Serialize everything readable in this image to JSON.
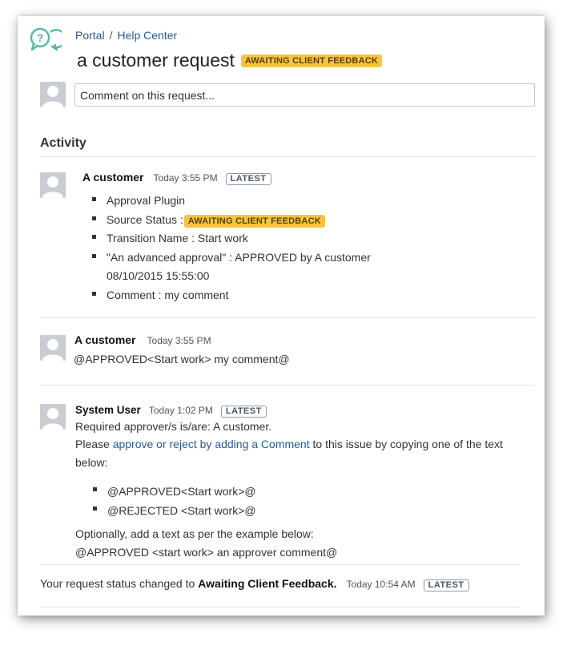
{
  "breadcrumb": {
    "portal": "Portal",
    "separator": "/",
    "help_center": "Help Center"
  },
  "request": {
    "title": "a customer request",
    "status": "AWAITING CLIENT FEEDBACK"
  },
  "comment_box": {
    "placeholder": "Comment on this request..."
  },
  "activity": {
    "heading": "Activity",
    "entries": [
      {
        "author": "A customer",
        "time": "Today 3:55 PM",
        "badge": "LATEST",
        "items": [
          {
            "text": "Approval Plugin"
          },
          {
            "label": "Source Status :",
            "status": "AWAITING CLIENT FEEDBACK"
          },
          {
            "text": "Transition Name : Start work"
          },
          {
            "text": "\"An advanced approval\" : APPROVED by A customer",
            "text2": "08/10/2015 15:55:00"
          },
          {
            "text": "Comment : my comment"
          }
        ]
      },
      {
        "author": "A customer",
        "time": "Today 3:55 PM",
        "body": "@APPROVED<Start work> my comment@"
      },
      {
        "author": "System User",
        "time": "Today 1:02 PM",
        "badge": "LATEST",
        "line1": "Required approver/s is/are: A customer.",
        "line2_prefix": "Please ",
        "line2_link": "approve or reject by adding a Comment",
        "line2_suffix": " to this issue by copying one of the text",
        "line3": "below:",
        "items": [
          "@APPROVED<Start work>@",
          "@REJECTED <Start work>@"
        ],
        "line4": "Optionally, add a text as per the example below:",
        "line5": "@APPROVED <start work> an approver comment@"
      }
    ]
  },
  "status_change": {
    "prefix": "Your request status changed to ",
    "status": "Awaiting Client Feedback.",
    "time": "Today 10:54 AM",
    "badge": "LATEST"
  },
  "colors": {
    "status_yellow": "#f6c342",
    "link_blue": "#2a5a8c",
    "logo_teal": "#59b5a8"
  },
  "icons": {
    "logo": "help-center-logo-icon",
    "avatar": "default-user-avatar-icon"
  }
}
